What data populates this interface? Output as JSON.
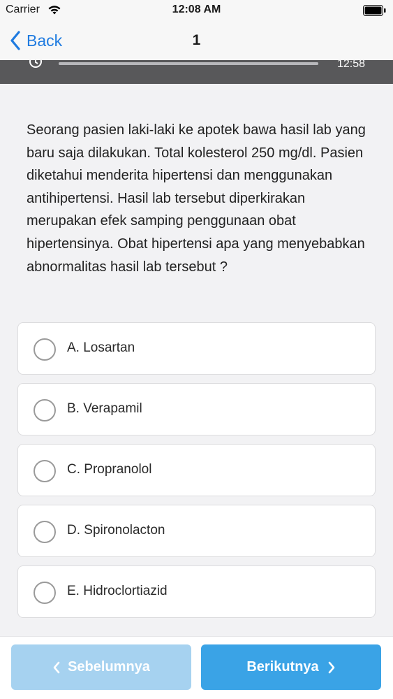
{
  "status_bar": {
    "carrier": "Carrier",
    "time": "12:08 AM"
  },
  "nav": {
    "back_label": "Back",
    "title": "1"
  },
  "timer": {
    "remaining": "12:58",
    "progress": 1.0
  },
  "question": {
    "text": "Seorang pasien laki-laki ke apotek bawa hasil lab yang baru saja dilakukan. Total kolesterol 250 mg/dl. Pasien diketahui menderita hipertensi dan menggunakan antihipertensi. Hasil lab tersebut diperkirakan merupakan efek samping penggunaan obat hipertensinya. Obat hipertensi apa yang menyebabkan abnormalitas hasil lab tersebut ?"
  },
  "options": [
    {
      "label": "A. Losartan",
      "selected": false
    },
    {
      "label": "B. Verapamil",
      "selected": false
    },
    {
      "label": "C. Propranolol",
      "selected": false
    },
    {
      "label": "D. Spironolacton",
      "selected": false
    },
    {
      "label": "E. Hidroclortiazid",
      "selected": false
    }
  ],
  "footer": {
    "prev_label": "Sebelumnya",
    "next_label": "Berikutnya"
  },
  "colors": {
    "accent": "#1f7be0",
    "next_button": "#3aa3e6",
    "prev_button_disabled": "#a6d2f0",
    "timer_bar": "#58585a"
  }
}
